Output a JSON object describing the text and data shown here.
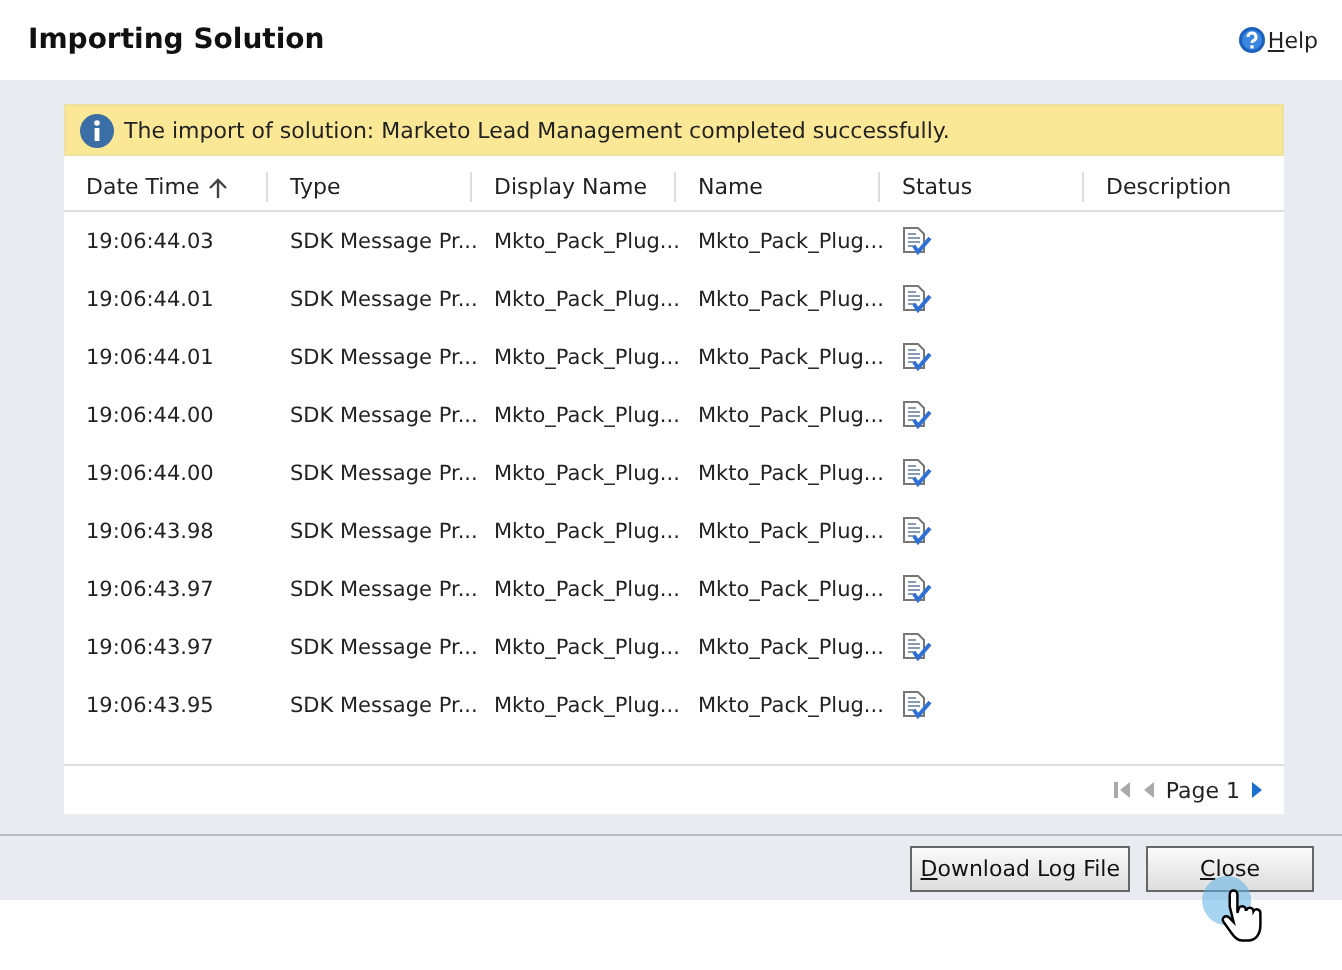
{
  "window": {
    "title": "Importing Solution",
    "help": "Help"
  },
  "banner": {
    "message": "The import of solution: Marketo Lead Management completed successfully."
  },
  "table": {
    "columns": [
      {
        "label": "Date Time",
        "sorted": true
      },
      {
        "label": "Type",
        "sorted": false
      },
      {
        "label": "Display Name",
        "sorted": false
      },
      {
        "label": "Name",
        "sorted": false
      },
      {
        "label": "Status",
        "sorted": false
      },
      {
        "label": "Description",
        "sorted": false
      }
    ],
    "rows": [
      {
        "date_time": "19:06:44.03",
        "type": "SDK Message Pr...",
        "display_name": "Mkto_Pack_Plug...",
        "name": "Mkto_Pack_Plug..."
      },
      {
        "date_time": "19:06:44.01",
        "type": "SDK Message Pr...",
        "display_name": "Mkto_Pack_Plug...",
        "name": "Mkto_Pack_Plug..."
      },
      {
        "date_time": "19:06:44.01",
        "type": "SDK Message Pr...",
        "display_name": "Mkto_Pack_Plug...",
        "name": "Mkto_Pack_Plug..."
      },
      {
        "date_time": "19:06:44.00",
        "type": "SDK Message Pr...",
        "display_name": "Mkto_Pack_Plug...",
        "name": "Mkto_Pack_Plug..."
      },
      {
        "date_time": "19:06:44.00",
        "type": "SDK Message Pr...",
        "display_name": "Mkto_Pack_Plug...",
        "name": "Mkto_Pack_Plug..."
      },
      {
        "date_time": "19:06:43.98",
        "type": "SDK Message Pr...",
        "display_name": "Mkto_Pack_Plug...",
        "name": "Mkto_Pack_Plug..."
      },
      {
        "date_time": "19:06:43.97",
        "type": "SDK Message Pr...",
        "display_name": "Mkto_Pack_Plug...",
        "name": "Mkto_Pack_Plug..."
      },
      {
        "date_time": "19:06:43.97",
        "type": "SDK Message Pr...",
        "display_name": "Mkto_Pack_Plug...",
        "name": "Mkto_Pack_Plug..."
      },
      {
        "date_time": "19:06:43.95",
        "type": "SDK Message Pr...",
        "display_name": "Mkto_Pack_Plug...",
        "name": "Mkto_Pack_Plug..."
      }
    ]
  },
  "pager": {
    "label": "Page 1"
  },
  "buttons": [
    {
      "label": "Download Log File"
    },
    {
      "label": "Close"
    }
  ]
}
